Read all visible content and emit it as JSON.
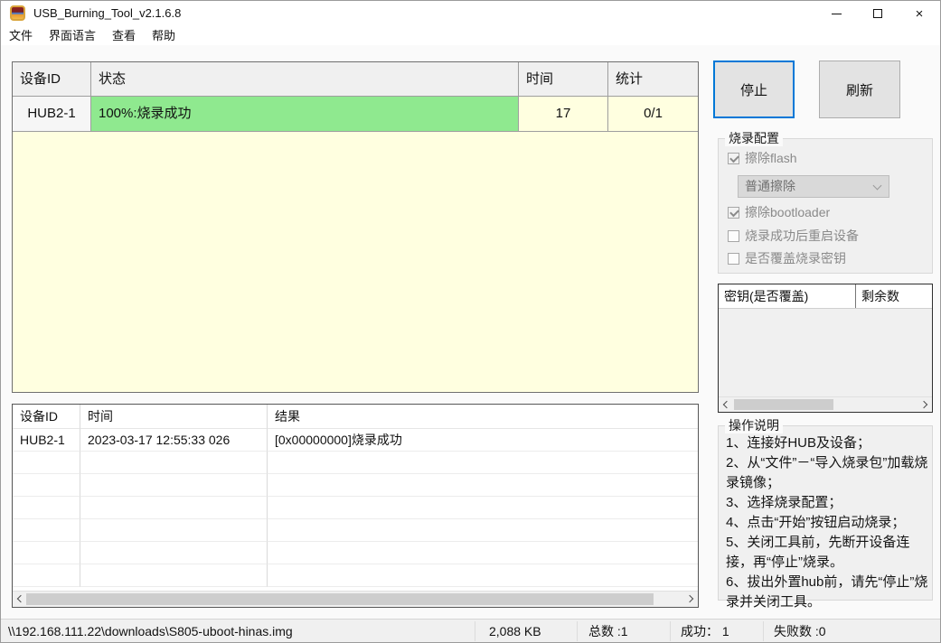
{
  "window": {
    "title": "USB_Burning_Tool_v2.1.6.8",
    "minimize_glyph": "–",
    "close_glyph": "×"
  },
  "menu": {
    "items": [
      "文件",
      "界面语言",
      "查看",
      "帮助"
    ]
  },
  "device_table": {
    "headers": [
      "设备ID",
      "状态",
      "时间",
      "统计"
    ],
    "rows": [
      {
        "device_id": "HUB2-1",
        "status": "100%:烧录成功",
        "time": "17",
        "stats": "0/1"
      }
    ]
  },
  "actions": {
    "stop_label": "停止",
    "refresh_label": "刷新"
  },
  "burn_config": {
    "title": "烧录配置",
    "erase_flash": {
      "label": "擦除flash",
      "checked": true
    },
    "erase_mode": {
      "value": "普通擦除"
    },
    "erase_bootloader": {
      "label": "擦除bootloader",
      "checked": true
    },
    "reboot_after_success": {
      "label": "烧录成功后重启设备",
      "checked": false
    },
    "overwrite_burn_key": {
      "label": "是否覆盖烧录密钥",
      "checked": false
    }
  },
  "key_table": {
    "headers": [
      "密钥(是否覆盖)",
      "剩余数"
    ],
    "rows": []
  },
  "instructions": {
    "title": "操作说明",
    "lines": [
      "1、连接好HUB及设备；",
      "2、从“文件”－“导入烧录包”加载烧录镜像；",
      "3、选择烧录配置；",
      "4、点击“开始”按钮启动烧录；",
      "5、关闭工具前，先断开设备连接，再“停止”烧录。",
      "6、拔出外置hub前，请先“停止”烧录并关闭工具。"
    ]
  },
  "log_table": {
    "headers": [
      "设备ID",
      "时间",
      "结果"
    ],
    "rows": [
      {
        "device_id": "HUB2-1",
        "time": "2023-03-17 12:55:33 026",
        "result": "[0x00000000]烧录成功"
      }
    ]
  },
  "status_bar": {
    "file_path": "\\\\192.168.111.22\\downloads\\S805-uboot-hinas.img",
    "file_size": "2,088 KB",
    "total": "总数 :1",
    "success": "成功： 1",
    "failed": "失败数 :0"
  },
  "icons": {
    "check_icon": "checkmark",
    "chevron_down_icon": "chevron-down",
    "scroll_left_icon": "chevron-left",
    "scroll_right_icon": "chevron-right"
  },
  "colors": {
    "accent_blue": "#0078D7",
    "success_green": "#8FE98F",
    "pending_yellow": "#FFFFE0",
    "header_gray": "#F0F0F0",
    "disabled_text": "#8A8A8A"
  }
}
